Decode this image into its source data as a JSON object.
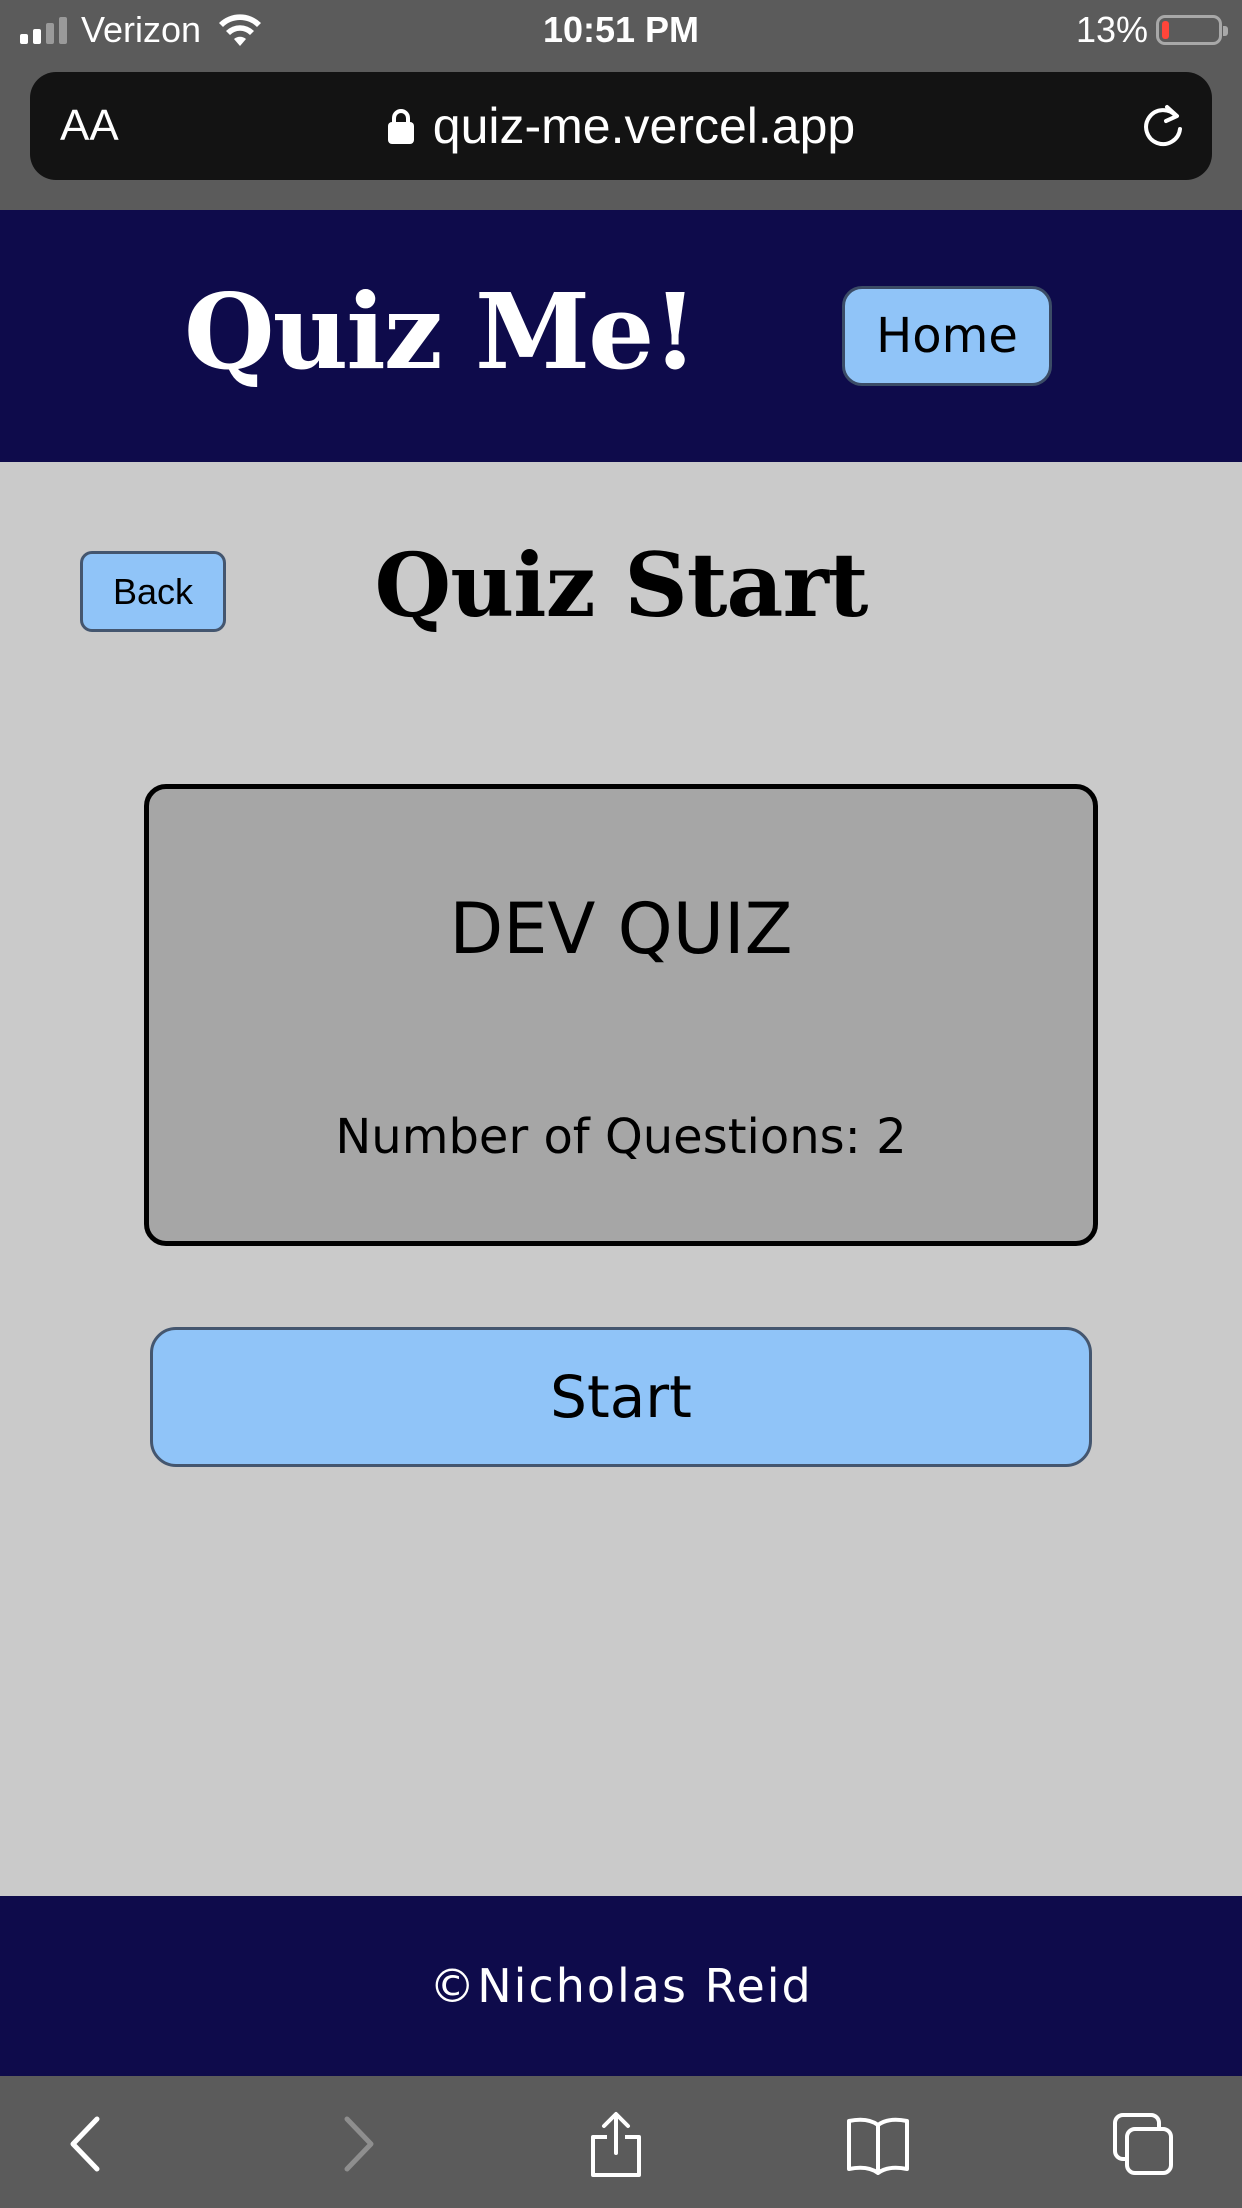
{
  "status_bar": {
    "carrier": "Verizon",
    "time": "10:51 PM",
    "battery_percent": "13%",
    "battery_level": 0.13,
    "signal_bars": 2
  },
  "browser": {
    "text_size_label": "AA",
    "url": "quiz-me.vercel.app"
  },
  "header": {
    "title": "Quiz Me!",
    "home_label": "Home"
  },
  "main": {
    "back_label": "Back",
    "page_title": "Quiz Start",
    "quiz": {
      "name": "DEV QUIZ",
      "question_count_text": "Number of Questions: 2"
    },
    "start_label": "Start"
  },
  "footer": {
    "text": "©Nicholas Reid"
  },
  "colors": {
    "brand_navy": "#0e0b4b",
    "button_blue": "#90c4f8",
    "page_bg": "#cacaca",
    "card_bg": "#a6a6a6"
  },
  "icons": {
    "lock": "lock-icon",
    "reload": "reload-icon",
    "wifi": "wifi-icon",
    "back": "chevron-left-icon",
    "forward": "chevron-right-icon",
    "share": "share-icon",
    "bookmarks": "book-icon",
    "tabs": "tabs-icon"
  }
}
